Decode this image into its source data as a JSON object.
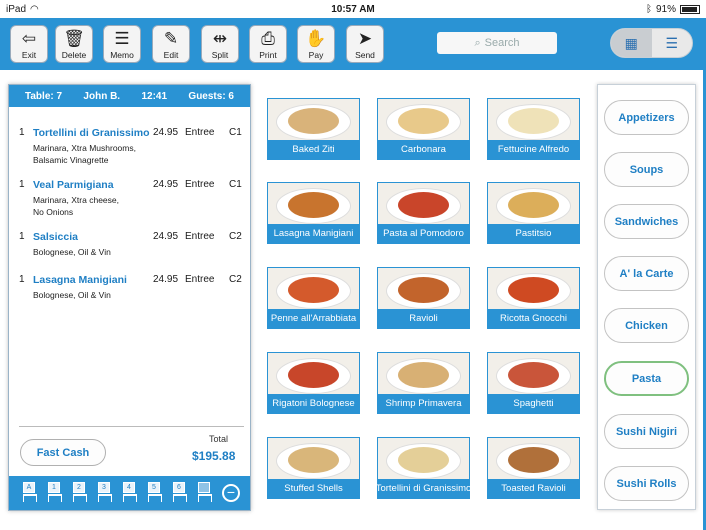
{
  "statusbar": {
    "device": "iPad",
    "wifi_icon": "wifi-icon",
    "time": "10:57 AM",
    "battery_percent": "91%"
  },
  "toolbar": {
    "buttons": [
      {
        "label": "Exit",
        "icon": "exit-icon",
        "glyph": "⇦"
      },
      {
        "label": "Delete",
        "icon": "trash-icon",
        "glyph": "🗑"
      },
      {
        "label": "Memo",
        "icon": "memo-icon",
        "glyph": "☰"
      },
      {
        "label": "Edit",
        "icon": "edit-icon",
        "glyph": "✎"
      },
      {
        "label": "Split",
        "icon": "split-icon",
        "glyph": "⇹"
      },
      {
        "label": "Print",
        "icon": "printer-icon",
        "glyph": "⎙"
      },
      {
        "label": "Pay",
        "icon": "pay-icon",
        "glyph": "✋"
      },
      {
        "label": "Send",
        "icon": "send-icon",
        "glyph": "➤"
      }
    ],
    "search_placeholder": "Search",
    "view_grid_icon": "grid-view-icon",
    "view_list_icon": "list-view-icon"
  },
  "ticket": {
    "table": "Table: 7",
    "server": "John B.",
    "time": "12:41",
    "guests": "Guests: 6",
    "orders": [
      {
        "qty": "1",
        "name": "Tortellini di Granissimo",
        "mods_line1": "Marinara, Xtra Mushrooms,",
        "mods_line2": "Balsamic Vinagrette",
        "price": "24.95",
        "course": "Entree",
        "seat": "C1"
      },
      {
        "qty": "1",
        "name": "Veal Parmigiana",
        "mods_line1": "Marinara, Xtra cheese,",
        "mods_line2": "No Onions",
        "price": "24.95",
        "course": "Entree",
        "seat": "C1"
      },
      {
        "qty": "1",
        "name": "Salsiccia",
        "mods_line1": "Bolognese, Oil & Vin",
        "mods_line2": "",
        "price": "24.95",
        "course": "Entree",
        "seat": "C2"
      },
      {
        "qty": "1",
        "name": "Lasagna Manigiani",
        "mods_line1": "Bolognese, Oil & Vin",
        "mods_line2": "",
        "price": "24.95",
        "course": "Entree",
        "seat": "C2"
      }
    ],
    "fast_cash": "Fast Cash",
    "total_label": "Total",
    "total_value": "$195.88",
    "seats": [
      "A",
      "1",
      "2",
      "3",
      "4",
      "5",
      "6",
      ""
    ],
    "remove_icon": "minus-circle-icon"
  },
  "menu_items": [
    {
      "name": "Baked Ziti",
      "color": "#d9b37a"
    },
    {
      "name": "Carbonara",
      "color": "#e8c98a"
    },
    {
      "name": "Fettucine Alfredo",
      "color": "#efe2b8"
    },
    {
      "name": "Lasagna Manigiani",
      "color": "#c8742e"
    },
    {
      "name": "Pasta al Pomodoro",
      "color": "#c9452a"
    },
    {
      "name": "Pastitsio",
      "color": "#dcae5a"
    },
    {
      "name": "Penne all'Arrabbiata",
      "color": "#d45a2c"
    },
    {
      "name": "Ravioli",
      "color": "#c2642c"
    },
    {
      "name": "Ricotta Gnocchi",
      "color": "#cf4a22"
    },
    {
      "name": "Rigatoni Bolognese",
      "color": "#c8462a"
    },
    {
      "name": "Shrimp Primavera",
      "color": "#d8b074"
    },
    {
      "name": "Spaghetti",
      "color": "#c9553a"
    },
    {
      "name": "Stuffed Shells",
      "color": "#d9b67a"
    },
    {
      "name": "Tortellini di Granissimo",
      "color": "#e4cf98"
    },
    {
      "name": "Toasted Ravioli",
      "color": "#b0703a"
    }
  ],
  "categories": [
    {
      "label": "Appetizers",
      "selected": false
    },
    {
      "label": "Soups",
      "selected": false
    },
    {
      "label": "Sandwiches",
      "selected": false
    },
    {
      "label": "A' la Carte",
      "selected": false
    },
    {
      "label": "Chicken",
      "selected": false
    },
    {
      "label": "Pasta",
      "selected": true
    },
    {
      "label": "Sushi Nigiri",
      "selected": false
    },
    {
      "label": "Sushi Rolls",
      "selected": false
    }
  ]
}
